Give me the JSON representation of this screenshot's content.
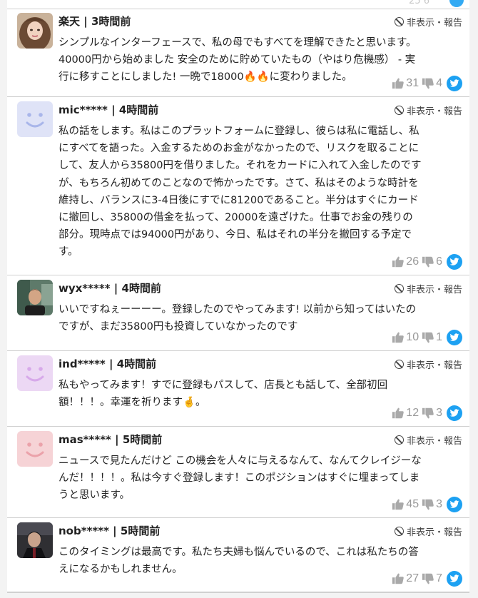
{
  "hide_report_label": "非表示・報告",
  "top_partial": {
    "text": "25  6"
  },
  "comments": [
    {
      "username": "楽天",
      "time": "3時間前",
      "body": "シンプルなインターフェースで、私の母でもすべてを理解できたと思います。\n40000円から始めました 安全のために貯めていたもの（やはり危機感） - 実\n行に移すことにしました! 一晩で18000🔥🔥に変わりました。",
      "likes": "31",
      "dislikes": "4",
      "avatar": "photo-woman"
    },
    {
      "username": "mic*****",
      "time": "4時間前",
      "body": "私の話をします。私はこのプラットフォームに登録し、彼らは私に電話し、私\nにすべてを語った。入金するためのお金がなかったので、リスクを取ることに\nして、友人から35800円を借りました。それをカードに入れて入金したのです\nが、もちろん初めてのことなので怖かったです。さて、私はそのような時計を\n維持し、バランスに3-4日後にすでに81200であること。半分はすぐにカード\nに撤回し、35800の借金を払って、20000を遠ざけた。仕事でお金の残りの\n部分。現時点では94000円があり、今日、私はそれの半分を撤回する予定で\nす。",
      "likes": "26",
      "dislikes": "6",
      "avatar": "smiley",
      "avatar_bg": "#dfe3f7",
      "avatar_fg": "#a9b6ea"
    },
    {
      "username": "wyx*****",
      "time": "4時間前",
      "body": "いいですねぇーーーー。登録したのでやってみます! 以前から知ってはいたの\nですが、まだ35800円も投資していなかったのです",
      "likes": "10",
      "dislikes": "1",
      "avatar": "photo-man"
    },
    {
      "username": "ind*****",
      "time": "4時間前",
      "body": "私もやってみます！すでに登録もパスして、店長とも話して、全部初回\n額！！！。幸運を祈ります🤞。",
      "likes": "12",
      "dislikes": "3",
      "avatar": "smiley",
      "avatar_bg": "#ecd8f4",
      "avatar_fg": "#d7a9ea"
    },
    {
      "username": "mas*****",
      "time": "5時間前",
      "body": "ニュースで見たんだけど この機会を人々に与えるなんて、なんてクレイジーな\nんだ！！！！。私は今すぐ登録します！このポジションはすぐに埋まってしま\nうと思います。",
      "likes": "45",
      "dislikes": "3",
      "avatar": "smiley",
      "avatar_bg": "#f6d3d6",
      "avatar_fg": "#eba2aa"
    },
    {
      "username": "nob*****",
      "time": "5時間前",
      "body": "このタイミングは最高です。私たち夫婦も悩んでいるので、これは私たちの答\nえになるかもしれません。",
      "likes": "27",
      "dislikes": "7",
      "avatar": "photo-dark"
    }
  ]
}
